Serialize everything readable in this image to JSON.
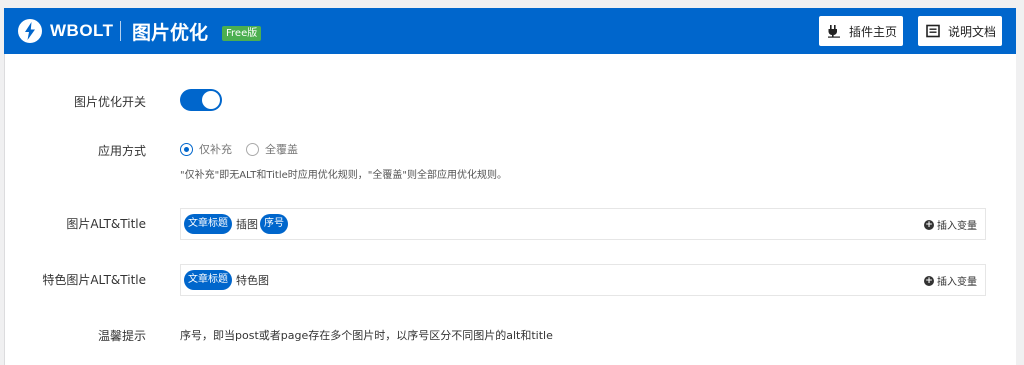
{
  "header": {
    "brand": "WBOLT",
    "title": "图片优化",
    "badge": "Free版",
    "plugin_home_label": "插件主页",
    "docs_label": "说明文档",
    "bg_color": "#0066cc"
  },
  "settings": {
    "switch": {
      "label": "图片优化开关",
      "enabled": true
    },
    "mode": {
      "label": "应用方式",
      "options": [
        "仅补充",
        "全覆盖"
      ],
      "selected": "仅补充",
      "hint": "\"仅补充\"即无ALT和Title时应用优化规则，\"全覆盖\"则全部应用优化规则。"
    },
    "img_alt": {
      "label": "图片ALT&Title",
      "tokens": [
        {
          "type": "var",
          "text": "文章标题"
        },
        {
          "type": "text",
          "text": "插图"
        },
        {
          "type": "var",
          "text": "序号"
        }
      ],
      "insert_label": "插入变量"
    },
    "feature_alt": {
      "label": "特色图片ALT&Title",
      "tokens": [
        {
          "type": "var",
          "text": "文章标题"
        },
        {
          "type": "text",
          "text": "特色图"
        }
      ],
      "insert_label": "插入变量"
    },
    "tip": {
      "label": "温馨提示",
      "text": "序号，即当post或者page存在多个图片时，以序号区分不同图片的alt和title"
    }
  }
}
